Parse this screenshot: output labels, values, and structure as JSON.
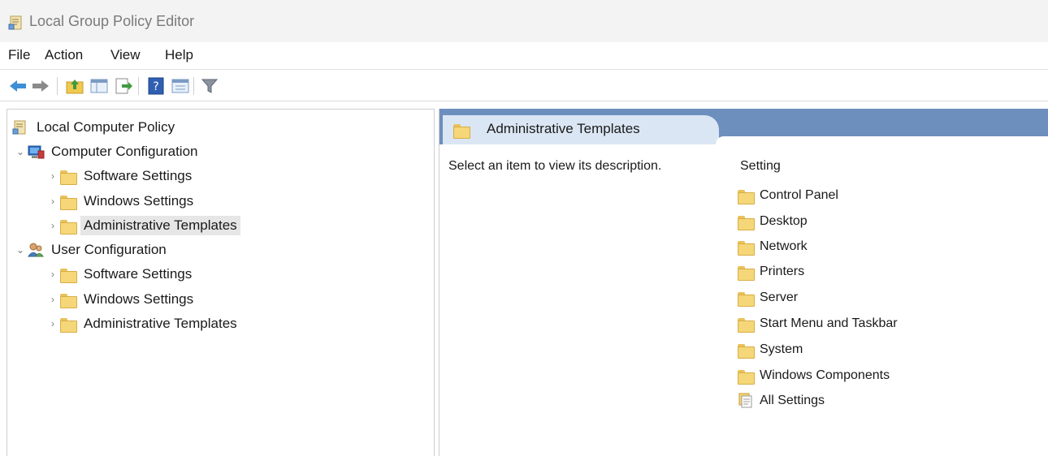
{
  "window": {
    "title": "Local Group Policy Editor"
  },
  "menu": {
    "file": "File",
    "action": "Action",
    "view": "View",
    "help": "Help"
  },
  "toolbar": {
    "buttons": [
      "back-arrow",
      "forward-arrow",
      "up-folder",
      "show-hide-tree",
      "export-list",
      "help",
      "properties",
      "filter"
    ]
  },
  "tree": {
    "root": "Local Computer Policy",
    "computer_configuration": {
      "label": "Computer Configuration",
      "children": [
        "Software Settings",
        "Windows Settings",
        "Administrative Templates"
      ]
    },
    "user_configuration": {
      "label": "User Configuration",
      "children": [
        "Software Settings",
        "Windows Settings",
        "Administrative Templates"
      ]
    },
    "selected": "Administrative Templates"
  },
  "details": {
    "header_title": "Administrative Templates",
    "description": "Select an item to view its description.",
    "column_header": "Setting",
    "items": [
      "Control Panel",
      "Desktop",
      "Network",
      "Printers",
      "Server",
      "Start Menu and Taskbar",
      "System",
      "Windows Components",
      "All Settings"
    ]
  },
  "colors": {
    "header_band": "#6c8fbe",
    "header_tab": "#dbe6f4",
    "folder": "#f5d779",
    "selection": "#e6e6e6"
  }
}
